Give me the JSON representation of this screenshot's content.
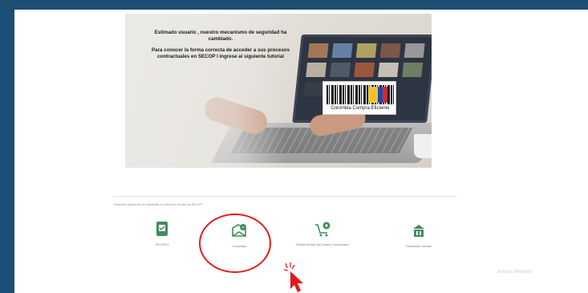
{
  "banner": {
    "line1": "Estimado usuario , nuestro mecanismo de seguridad ha cambiado.",
    "line2": "Para conocer la forma correcta de acceder a sus procesos contractuales en SECOP I  ingrese al siguiente tutorial",
    "logo_text": "Colombia Compra Eficiente"
  },
  "intro_text": "Formulario para envío de solicitudes a la Mesa de Servicio de SECOP I",
  "tiles": [
    {
      "label": "SECOP II",
      "icon": "secop-ii-icon"
    },
    {
      "label": "Consultas",
      "icon": "consultas-icon"
    },
    {
      "label": "Tienda Virtual del Estado Colombiano",
      "icon": "tienda-virtual-icon"
    },
    {
      "label": "Entidades Unidas",
      "icon": "entidades-icon"
    }
  ],
  "ghost_text": "Activar Windows",
  "colors": {
    "page_bg": "#1d4e73",
    "accent_green": "#3e8e5c",
    "highlight_red": "#e21b1b"
  }
}
